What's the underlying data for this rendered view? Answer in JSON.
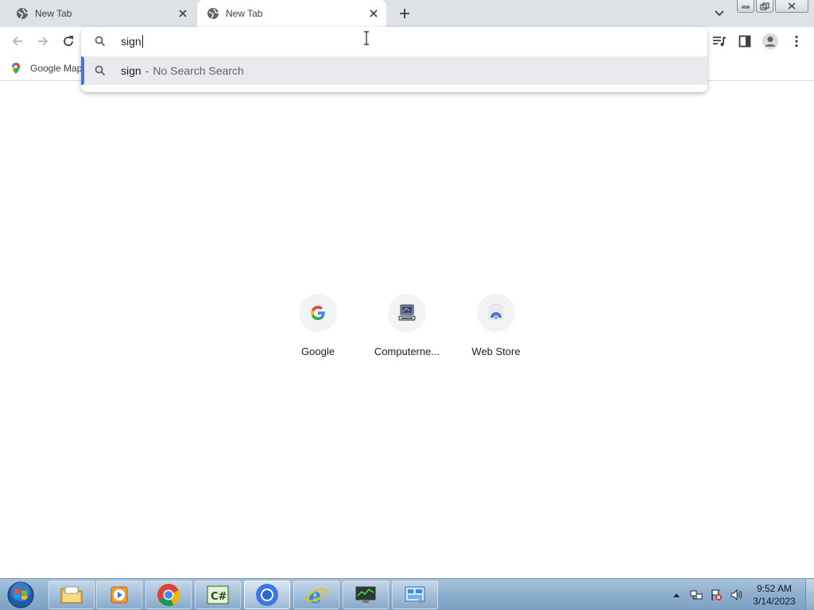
{
  "browser": {
    "tabs": [
      {
        "title": "New Tab",
        "active": false
      },
      {
        "title": "New Tab",
        "active": true
      }
    ]
  },
  "omnibox": {
    "typed_text": "sign",
    "suggestion": {
      "text": "sign",
      "separator": "-",
      "description": "No Search Search"
    }
  },
  "bookmarks": [
    {
      "label": "Google Map"
    }
  ],
  "shortcuts": [
    {
      "label": "Google",
      "icon": "google-g-icon"
    },
    {
      "label": "Computerne...",
      "icon": "computer-icon"
    },
    {
      "label": "Web Store",
      "icon": "web-store-icon"
    }
  ],
  "taskbar": {
    "apps": [
      "file-explorer",
      "media-player",
      "chrome",
      "csharp-app",
      "chromium",
      "internet-explorer",
      "network-monitor",
      "control-panel"
    ],
    "clock": {
      "time": "9:52 AM",
      "date": "3/14/2023"
    }
  },
  "colors": {
    "tabstrip": "#dee1e6",
    "suggestion_highlight": "#e8eaed",
    "accent": "#4b74d1"
  }
}
